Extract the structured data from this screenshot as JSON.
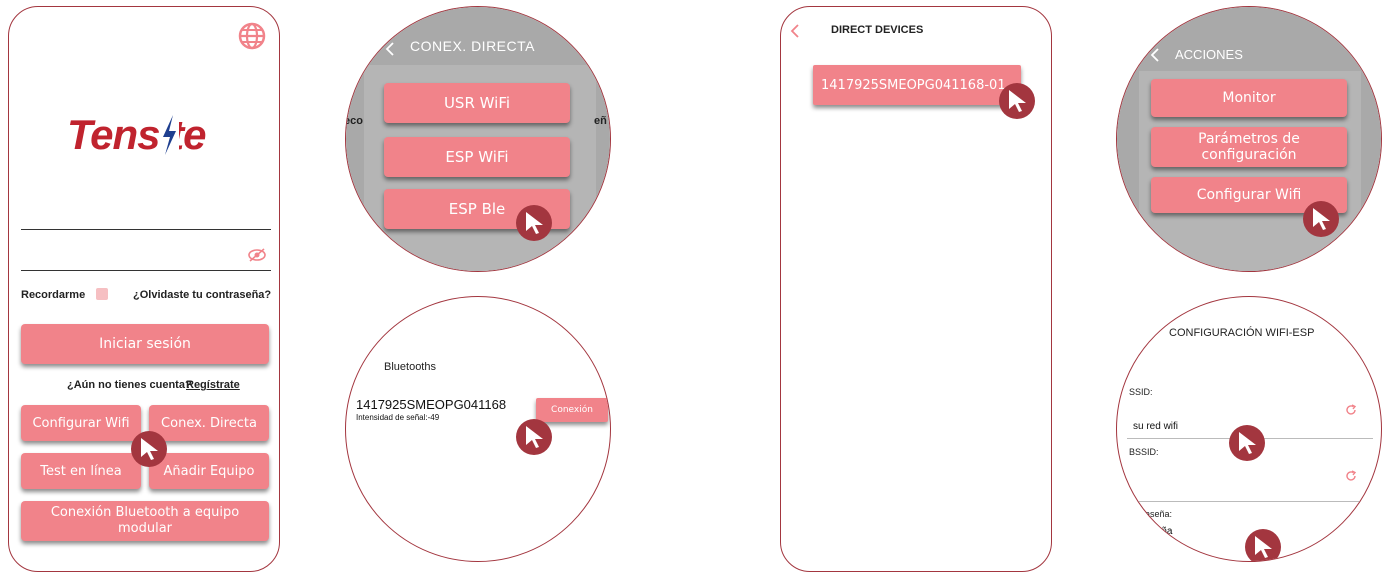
{
  "colors": {
    "accent": "#f1838a",
    "border": "#a3363f",
    "overlay": "#a9a9a9"
  },
  "login": {
    "globe_icon": "globe-icon",
    "logo": "Tensite",
    "eye_icon": "eye-slash-icon",
    "remember_label": "Recordarme",
    "forgot_link": "¿Olvidaste tu contraseña?",
    "login_button": "Iniciar sesión",
    "no_account": "¿Aún no tienes cuenta?",
    "register_link": "Regístrate",
    "btn_config_wifi": "Configurar Wifi",
    "btn_conex_directa": "Conex. Directa",
    "btn_test": "Test en línea",
    "btn_add": "Añadir Equipo",
    "btn_bluetooth": "Conexión Bluetooth a equipo modular"
  },
  "conex": {
    "title": "CONEX. DIRECTA",
    "options": [
      "USR WiFi",
      "ESP WiFi",
      "ESP Ble"
    ],
    "side_left": "eco",
    "side_right": "eñ"
  },
  "bluetooth": {
    "title": "Bluetooths",
    "device_name": "1417925SMEOPG041168",
    "signal": "Intensidad de señal:-49",
    "connect_button": "Conexión"
  },
  "direct": {
    "title": "DIRECT DEVICES",
    "device": "1417925SMEOPG041168-01"
  },
  "acciones": {
    "title": "ACCIONES",
    "monitor": "Monitor",
    "params": "Parámetros de configuración",
    "config_wifi": "Configurar Wifi"
  },
  "wifi_esp": {
    "title": "CONFIGURACIÓN WIFI-ESP",
    "ssid_label": "SSID:",
    "ssid_value": "su red wifi",
    "bssid_label": "BSSID:",
    "password_label": "Contraseña:",
    "password_value": "contraseña",
    "refresh_icon": "refresh-icon"
  }
}
